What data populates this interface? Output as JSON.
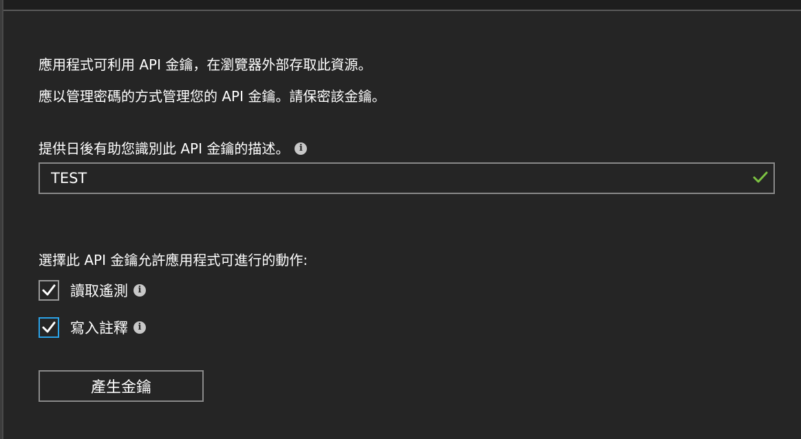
{
  "intro": {
    "line1": "應用程式可利用 API 金鑰，在瀏覽器外部存取此資源。",
    "line2": "應以管理密碼的方式管理您的 API 金鑰。請保密該金鑰。"
  },
  "description": {
    "label": "提供日後有助您識別此 API 金鑰的描述。",
    "value": "TEST",
    "valid": true
  },
  "permissions": {
    "heading": "選擇此 API 金鑰允許應用程式可進行的動作:",
    "items": [
      {
        "label": "讀取遙測",
        "checked": true
      },
      {
        "label": "寫入註釋",
        "checked": true
      }
    ]
  },
  "actions": {
    "generate_label": "產生金鑰"
  },
  "colors": {
    "background": "#252525",
    "valid_check": "#7cc242",
    "focus_border": "#2ba3e8"
  }
}
